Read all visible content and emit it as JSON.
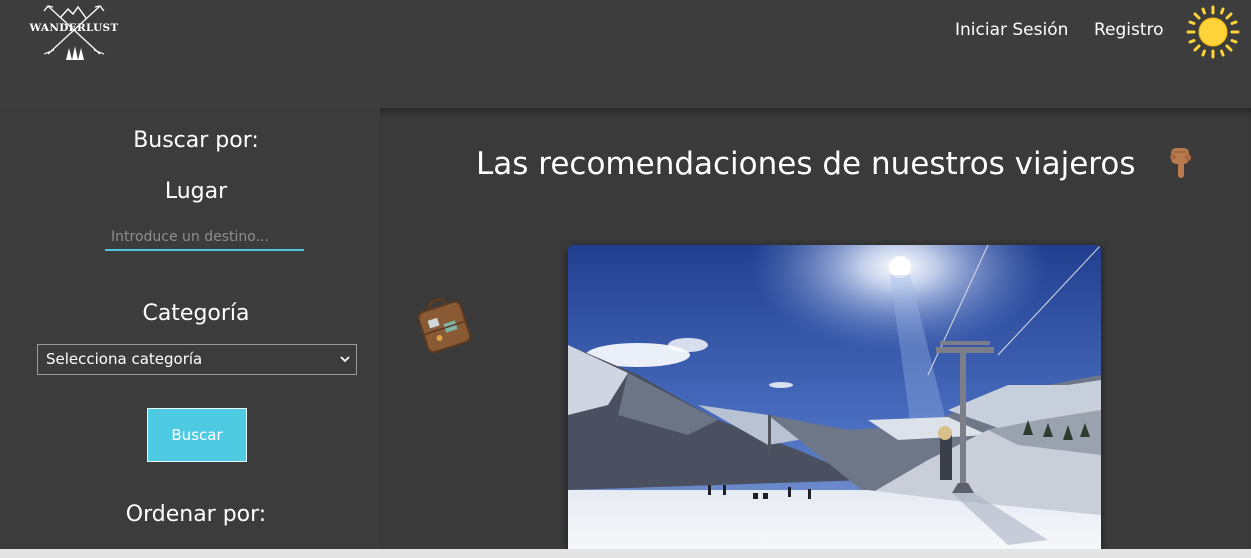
{
  "header": {
    "logo_text": "WANDERLUST",
    "nav": {
      "login": "Iniciar Sesión",
      "register": "Registro"
    },
    "theme_toggle_icon": "sun-icon"
  },
  "sidebar": {
    "search_heading": "Buscar por:",
    "place_label": "Lugar",
    "place_input": {
      "placeholder": "Introduce un destino...",
      "value": ""
    },
    "category_label": "Categoría",
    "category_select": {
      "selected": "Selecciona categoría"
    },
    "search_button": "Buscar",
    "sort_heading": "Ordenar por:"
  },
  "main": {
    "title": "Las recomendaciones de nuestros viajeros",
    "title_icon": "pointing-down-hand-icon",
    "side_icon": "suitcase-icon",
    "photo": {
      "subject": "snowy-ski-slope-photo"
    }
  },
  "colors": {
    "background": "#3c3c3c",
    "accent": "#4fcae3",
    "text": "#ffffff",
    "sun": "#ffd43b"
  }
}
